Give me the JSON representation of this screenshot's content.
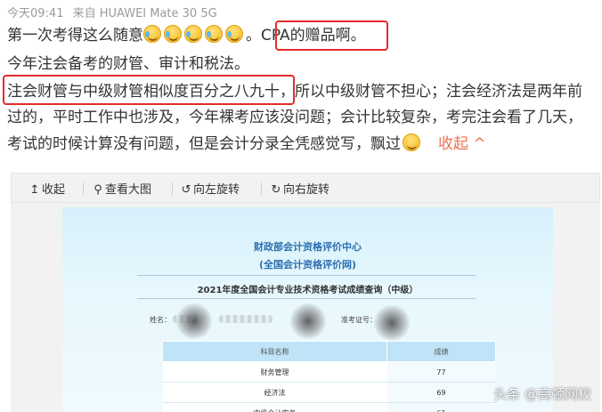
{
  "post": {
    "time": "今天09:41",
    "source": "来自 HUAWEI Mate 30 5G",
    "line1_text": "第一次考得这么随意",
    "line1_tail": "。CPA的赠品啊。",
    "line2": "今年注会备考的财管、审计和税法。",
    "line3_highlight": "注会财管与中级财管相似度百分之八九十",
    "line3_rest": "，所以中级财管不担心；注会经济法是两年前",
    "line4": "过的，平时工作中也涉及，今年裸考应该没问题；会计比较复杂，考完注会看了几天，",
    "line5": "考试的时候计算没有问题，但是会计分录全凭感觉写，飘过",
    "collapse": "收起",
    "emoji_names": [
      "laugh-cry-icon",
      "laugh-cry-icon",
      "laugh-cry-icon",
      "laugh-cry-icon",
      "laugh-cry-icon",
      "smirk-icon"
    ]
  },
  "toolbar": {
    "collapse": "收起",
    "view_large": "查看大图",
    "rotate_left": "向左旋转",
    "rotate_right": "向右旋转"
  },
  "certificate": {
    "org": "财政部会计资格评价中心",
    "org_sub": "(全国会计资格评价网)",
    "query_title": "2021年度全国会计专业技术资格考试成绩查询（中级）",
    "name_label": "姓名：",
    "id_label": "准考证号：",
    "table_headers": [
      "科目名称",
      "成绩"
    ],
    "rows": [
      {
        "subject": "财务管理",
        "score": "77"
      },
      {
        "subject": "经济法",
        "score": "69"
      },
      {
        "subject": "中级会计实务",
        "score": "61"
      }
    ]
  },
  "watermark": "头条 @高顿网校",
  "colors": {
    "highlight_border": "#e52b2b",
    "link": "#eb7350",
    "meta_text": "#9a9a9a",
    "cert_blue": "#2c6fb1"
  }
}
